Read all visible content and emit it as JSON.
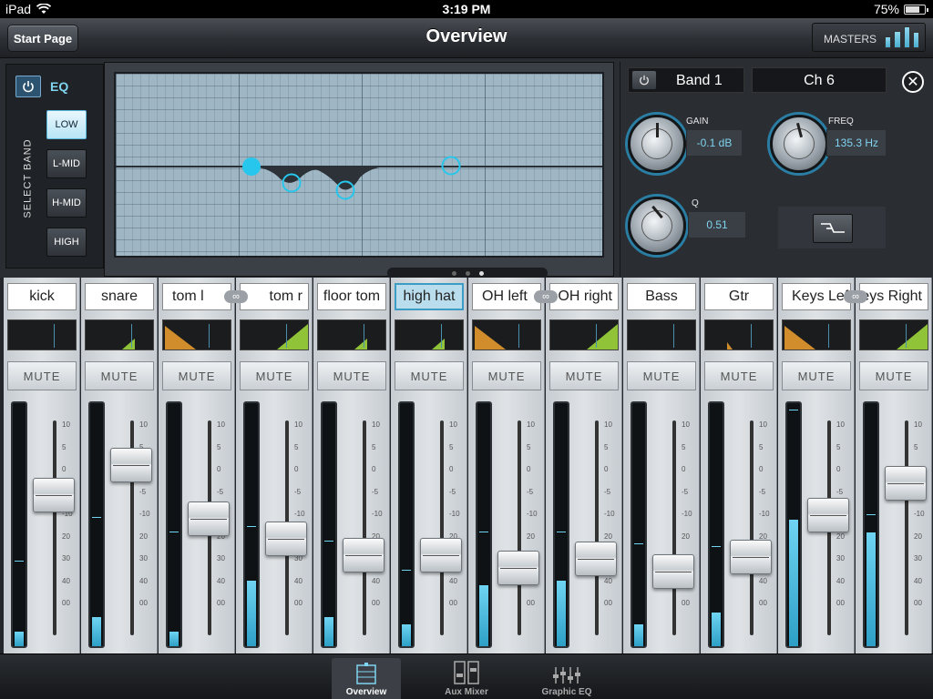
{
  "status": {
    "device": "iPad",
    "time": "3:19 PM",
    "battery": "75%",
    "battery_level": 0.75
  },
  "header": {
    "title": "Overview",
    "start_label": "Start Page",
    "masters_label": "MASTERS"
  },
  "eq": {
    "label": "EQ",
    "select_band_label": "SELECT BAND",
    "bands": [
      "LOW",
      "L-MID",
      "H-MID",
      "HIGH"
    ],
    "active_band": "LOW",
    "band_title": "Band 1",
    "channel": "Ch 6",
    "gain_label": "GAIN",
    "gain_value": "-0.1 dB",
    "freq_label": "FREQ",
    "freq_value": "135.3 Hz",
    "q_label": "Q",
    "q_value": "0.51",
    "page_count": 3,
    "current_page": 3
  },
  "mixer": {
    "mute_label": "MUTE",
    "scale": [
      "10",
      "5",
      "0",
      "-5",
      "-10",
      "20",
      "30",
      "40",
      "00"
    ],
    "channels": [
      {
        "name": "kick",
        "fader": 0.68,
        "meter": 0.06,
        "peak": 0.35
      },
      {
        "name": "snare",
        "fader": 0.85,
        "meter": 0.12,
        "peak": 0.53
      },
      {
        "name": "tom l",
        "fader": 0.55,
        "meter": 0.06,
        "peak": 0.47
      },
      {
        "name": "tom r",
        "fader": 0.44,
        "meter": 0.27,
        "peak": 0.49
      },
      {
        "name": "floor tom",
        "fader": 0.35,
        "meter": 0.12,
        "peak": 0.43
      },
      {
        "name": "high hat",
        "fader": 0.35,
        "meter": 0.09,
        "peak": 0.31
      },
      {
        "name": "OH left",
        "fader": 0.28,
        "meter": 0.25,
        "peak": 0.47
      },
      {
        "name": "OH right",
        "fader": 0.33,
        "meter": 0.27,
        "peak": 0.47
      },
      {
        "name": "Bass",
        "fader": 0.26,
        "meter": 0.09,
        "peak": 0.42
      },
      {
        "name": "Gtr",
        "fader": 0.34,
        "meter": 0.14,
        "peak": 0.41
      },
      {
        "name": "Keys Left",
        "fader": 0.57,
        "meter": 0.52,
        "peak": 0.97
      },
      {
        "name": "Keys Right",
        "fader": 0.75,
        "meter": 0.47,
        "peak": 0.54
      }
    ],
    "selected": "high hat"
  },
  "tabs": [
    "Overview",
    "Aux Mixer",
    "Graphic EQ"
  ],
  "active_tab": "Overview"
}
